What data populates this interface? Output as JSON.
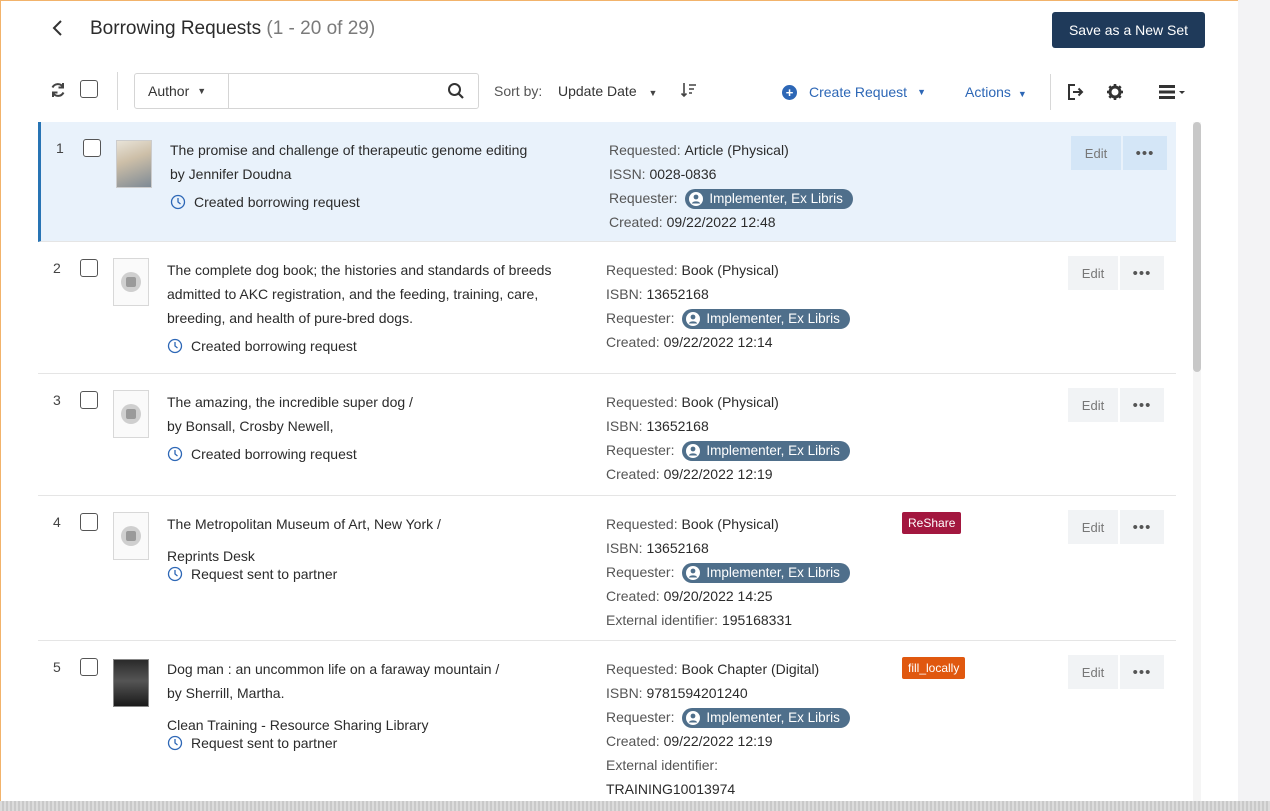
{
  "header": {
    "title": "Borrowing Requests",
    "count": "(1 - 20 of 29)",
    "save_set_label": "Save as a New Set"
  },
  "toolbar": {
    "search_field": "Author",
    "search_value": "",
    "sort_label": "Sort by:",
    "sort_value": "Update Date",
    "create_request_label": "Create Request",
    "actions_label": "Actions"
  },
  "labels": {
    "requested": "Requested:",
    "requester": "Requester:",
    "created": "Created:",
    "external_identifier": "External identifier:",
    "edit": "Edit",
    "more": "•••"
  },
  "rows": [
    {
      "num": "1",
      "title": "The promise and challenge of therapeutic genome editing",
      "by": "by Jennifer Doudna",
      "status": "Created borrowing request",
      "requested": "Article (Physical)",
      "id_label": "ISSN:",
      "id_value": "0028-0836",
      "requester": "Implementer, Ex Libris",
      "created": "09/22/2022 12:48"
    },
    {
      "num": "2",
      "title": "The complete dog book; the histories and standards of breeds admitted to AKC registration, and the feeding, training, care, breeding, and health of pure-bred dogs.",
      "status": "Created borrowing request",
      "requested": "Book (Physical)",
      "id_label": "ISBN:",
      "id_value": "13652168",
      "requester": "Implementer, Ex Libris",
      "created": "09/22/2022 12:14"
    },
    {
      "num": "3",
      "title": "The amazing, the incredible super dog /",
      "by": "by Bonsall, Crosby Newell,",
      "status": "Created borrowing request",
      "requested": "Book (Physical)",
      "id_label": "ISBN:",
      "id_value": "13652168",
      "requester": "Implementer, Ex Libris",
      "created": "09/22/2022 12:19"
    },
    {
      "num": "4",
      "title": "The Metropolitan Museum of Art, New York /",
      "partner": "Reprints Desk",
      "status": "Request sent to partner",
      "requested": "Book (Physical)",
      "id_label": "ISBN:",
      "id_value": "13652168",
      "requester": "Implementer, Ex Libris",
      "created": "09/20/2022 14:25",
      "external_id": "195168331",
      "tag": "ReShare",
      "tag_color": "#a3173f"
    },
    {
      "num": "5",
      "title": "Dog man : an uncommon life on a faraway mountain /",
      "by": "by Sherrill, Martha.",
      "partner": "Clean Training - Resource Sharing Library",
      "status": "Request sent to partner",
      "requested": "Book Chapter (Digital)",
      "id_label": "ISBN:",
      "id_value": "9781594201240",
      "requester": "Implementer, Ex Libris",
      "created": "09/22/2022 12:19",
      "external_id": "TRAINING10013974",
      "tag": "fill_locally",
      "tag_color": "#e0580f"
    }
  ],
  "colors": {
    "accent": "#2d67b6",
    "primary_button": "#1f3a5a",
    "selected_row": "#e9f2fb",
    "user_pill": "#4f6f8b"
  }
}
